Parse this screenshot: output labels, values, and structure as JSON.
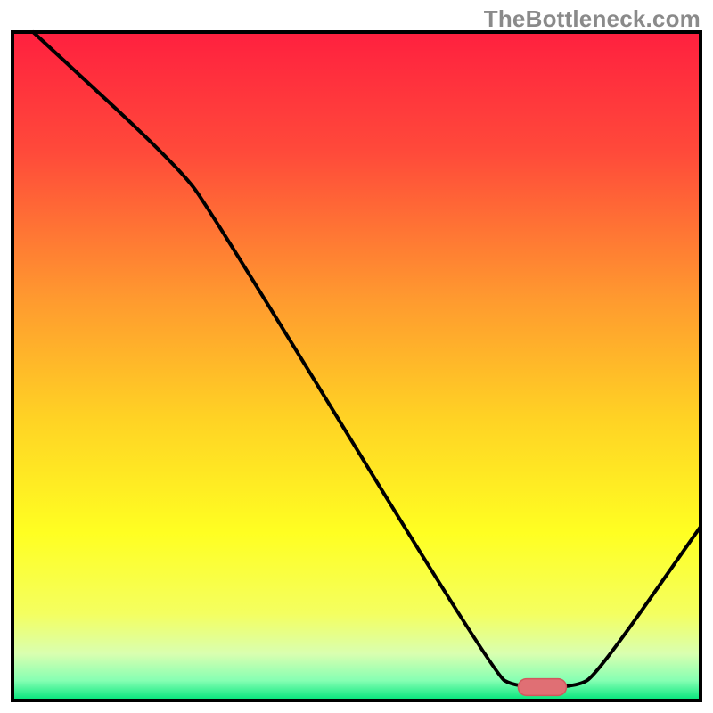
{
  "watermark": "TheBottleneck.com",
  "chart_data": {
    "type": "line",
    "title": "",
    "xlabel": "",
    "ylabel": "",
    "xlim": [
      0,
      100
    ],
    "ylim": [
      0,
      100
    ],
    "series": [
      {
        "name": "bottleneck-curve",
        "points": [
          {
            "x": 3,
            "y": 100
          },
          {
            "x": 24,
            "y": 80
          },
          {
            "x": 29,
            "y": 73
          },
          {
            "x": 70,
            "y": 4
          },
          {
            "x": 73,
            "y": 2
          },
          {
            "x": 82,
            "y": 2
          },
          {
            "x": 85,
            "y": 4
          },
          {
            "x": 100,
            "y": 26
          }
        ]
      }
    ],
    "marker": {
      "x": 77,
      "y": 2,
      "w": 7,
      "h": 2.5
    },
    "background_gradient": {
      "stops": [
        {
          "offset": 0.0,
          "color": "#ff203f"
        },
        {
          "offset": 0.18,
          "color": "#ff4a3a"
        },
        {
          "offset": 0.4,
          "color": "#ff9a2f"
        },
        {
          "offset": 0.58,
          "color": "#ffd324"
        },
        {
          "offset": 0.75,
          "color": "#ffff22"
        },
        {
          "offset": 0.87,
          "color": "#f4ff60"
        },
        {
          "offset": 0.93,
          "color": "#d9ffb0"
        },
        {
          "offset": 0.97,
          "color": "#86ffb3"
        },
        {
          "offset": 1.0,
          "color": "#00e47a"
        }
      ]
    },
    "colors": {
      "plot_border": "#000000",
      "curve": "#000000",
      "marker_fill": "#e06f74",
      "marker_stroke": "#d1575c"
    }
  }
}
